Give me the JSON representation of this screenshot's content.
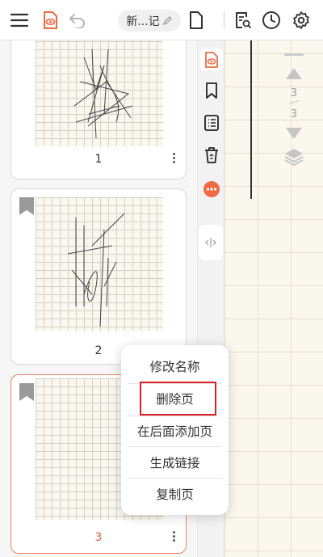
{
  "header": {
    "title": "新...记",
    "icons": [
      "menu-icon",
      "view-mode-icon",
      "undo-icon",
      "edit-pencil-icon",
      "page-icon",
      "search-doc-icon",
      "history-clock-icon",
      "settings-gear-icon"
    ]
  },
  "thumbnails": {
    "pages": [
      {
        "number": "1",
        "bookmarked": false,
        "active": false
      },
      {
        "number": "2",
        "bookmarked": true,
        "active": false
      },
      {
        "number": "3",
        "bookmarked": true,
        "active": true
      }
    ]
  },
  "side_toolbar": {
    "tools": [
      "view-mode-icon",
      "bookmark-icon",
      "outline-list-icon",
      "recycle-bin-icon",
      "more-icon",
      "resize-handle-icon"
    ]
  },
  "pager": {
    "current": "3",
    "total": "3"
  },
  "context_menu": {
    "items": [
      "修改名称",
      "删除页",
      "在后面添加页",
      "生成链接",
      "复制页"
    ],
    "highlighted": "删除页"
  },
  "colors": {
    "accent": "#f0826a",
    "active_text": "#e8603f",
    "highlight_box": "#d9232a"
  }
}
